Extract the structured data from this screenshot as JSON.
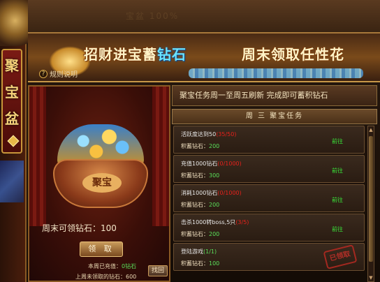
{
  "sidebar": {
    "emblem_chars": [
      "聚",
      "宝",
      "盆"
    ]
  },
  "header": {
    "faded_text": "宝盆 100%"
  },
  "banner": {
    "title_part1": "招财进宝蓄",
    "title_highlight": "钻石",
    "title_part2": "周末领取任性花",
    "rules_label": "规则说明"
  },
  "treasure": {
    "pot_label": "聚宝",
    "weekend_text": "周末可领钻石：100",
    "claim_button": "领 取",
    "week_recharged_label": "本周已充值：",
    "week_recharged_value": "0钻石",
    "last_week_label": "上周未领取的钻石：",
    "last_week_value": "600",
    "retrieve_button": "找回"
  },
  "tasks_panel": {
    "info_text": "聚宝任务周一至周五刷新 完成即可蓄积钻石",
    "day_header": "周 三 聚宝任务",
    "tasks": [
      {
        "name": "活跃度达到50",
        "progress": "(35/50)",
        "done": false,
        "reward_label": "积蓄钻石：",
        "reward_value": "200",
        "action": "前往"
      },
      {
        "name": "充值1000钻石",
        "progress": "(0/1000)",
        "done": false,
        "reward_label": "积蓄钻石：",
        "reward_value": "300",
        "action": "前往"
      },
      {
        "name": "消耗1000钻石",
        "progress": "(0/1000)",
        "done": false,
        "reward_label": "积蓄钻石：",
        "reward_value": "200",
        "action": "前往"
      },
      {
        "name": "击杀1000转boss,5只",
        "progress": "(3/5)",
        "done": false,
        "reward_label": "积蓄钻石：",
        "reward_value": "200",
        "action": "前往"
      },
      {
        "name": "登陆游戏",
        "progress": "(1/1)",
        "done": true,
        "reward_label": "积蓄钻石：",
        "reward_value": "100",
        "stamp": "已领取"
      }
    ]
  },
  "colors": {
    "accent_gold": "#c8963a",
    "progress_incomplete": "#e8201a",
    "progress_complete": "#5ae05a",
    "go_link": "#3ae83a"
  }
}
